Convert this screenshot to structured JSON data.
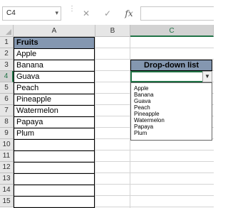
{
  "formula_bar": {
    "name_box": "C4",
    "cancel_icon": "✕",
    "enter_icon": "✓",
    "fx_label": "fx",
    "formula": ""
  },
  "columns": [
    "A",
    "B",
    "C"
  ],
  "rows": [
    "1",
    "2",
    "3",
    "4",
    "5",
    "6",
    "7",
    "8",
    "9",
    "10",
    "11",
    "12",
    "13",
    "14",
    "15"
  ],
  "fruits": {
    "header": "Fruits",
    "items": [
      "Apple",
      "Banana",
      "Guava",
      "Peach",
      "Pineapple",
      "Watermelon",
      "Papaya",
      "Plum"
    ]
  },
  "dropdown": {
    "label": "Drop-down list",
    "selected": "",
    "options": [
      "Apple",
      "Banana",
      "Guava",
      "Peach",
      "Pineapple",
      "Watermelon",
      "Papaya",
      "Plum"
    ]
  },
  "colors": {
    "header_fill": "#8497b0",
    "accent": "#217346"
  }
}
